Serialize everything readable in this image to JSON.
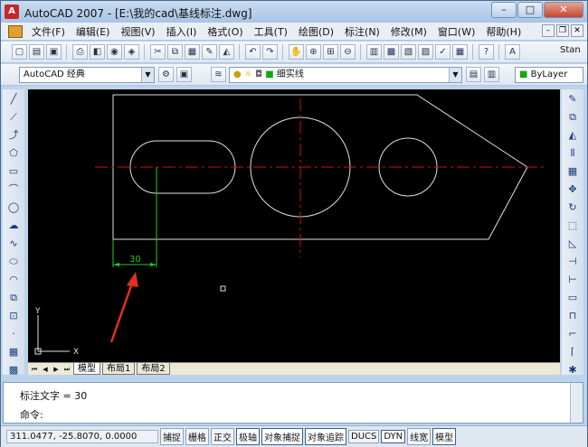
{
  "window": {
    "title": "AutoCAD 2007 - [E:\\我的cad\\基线标注.dwg]",
    "app_icon": "A",
    "min": "–",
    "max": "□",
    "close": "✕"
  },
  "menu": [
    "文件(F)",
    "编辑(E)",
    "视图(V)",
    "插入(I)",
    "格式(O)",
    "工具(T)",
    "绘图(D)",
    "标注(N)",
    "修改(M)",
    "窗口(W)",
    "帮助(H)"
  ],
  "toolbar2": {
    "workspace": "AutoCAD 经典",
    "layer": "细实线",
    "color": "ByLayer",
    "stand": "Stan"
  },
  "drawing": {
    "dimension_text": "30",
    "dimension_color": "#22cc22",
    "centerline_color": "#cc1111",
    "outline_color": "#e0e0e0",
    "arrow_color": "#e03020",
    "ucs_x": "X",
    "ucs_y": "Y"
  },
  "tabs": {
    "model": "模型",
    "layout1": "布局1",
    "layout2": "布局2"
  },
  "command": {
    "history": "标注文字 = 30",
    "prompt": "命令:"
  },
  "status": {
    "coords": "311.0477, -25.8070, 0.0000",
    "buttons": [
      "捕捉",
      "栅格",
      "正交",
      "极轴",
      "对象捕捉",
      "对象追踪",
      "DUCS",
      "DYN",
      "线宽",
      "模型"
    ]
  }
}
